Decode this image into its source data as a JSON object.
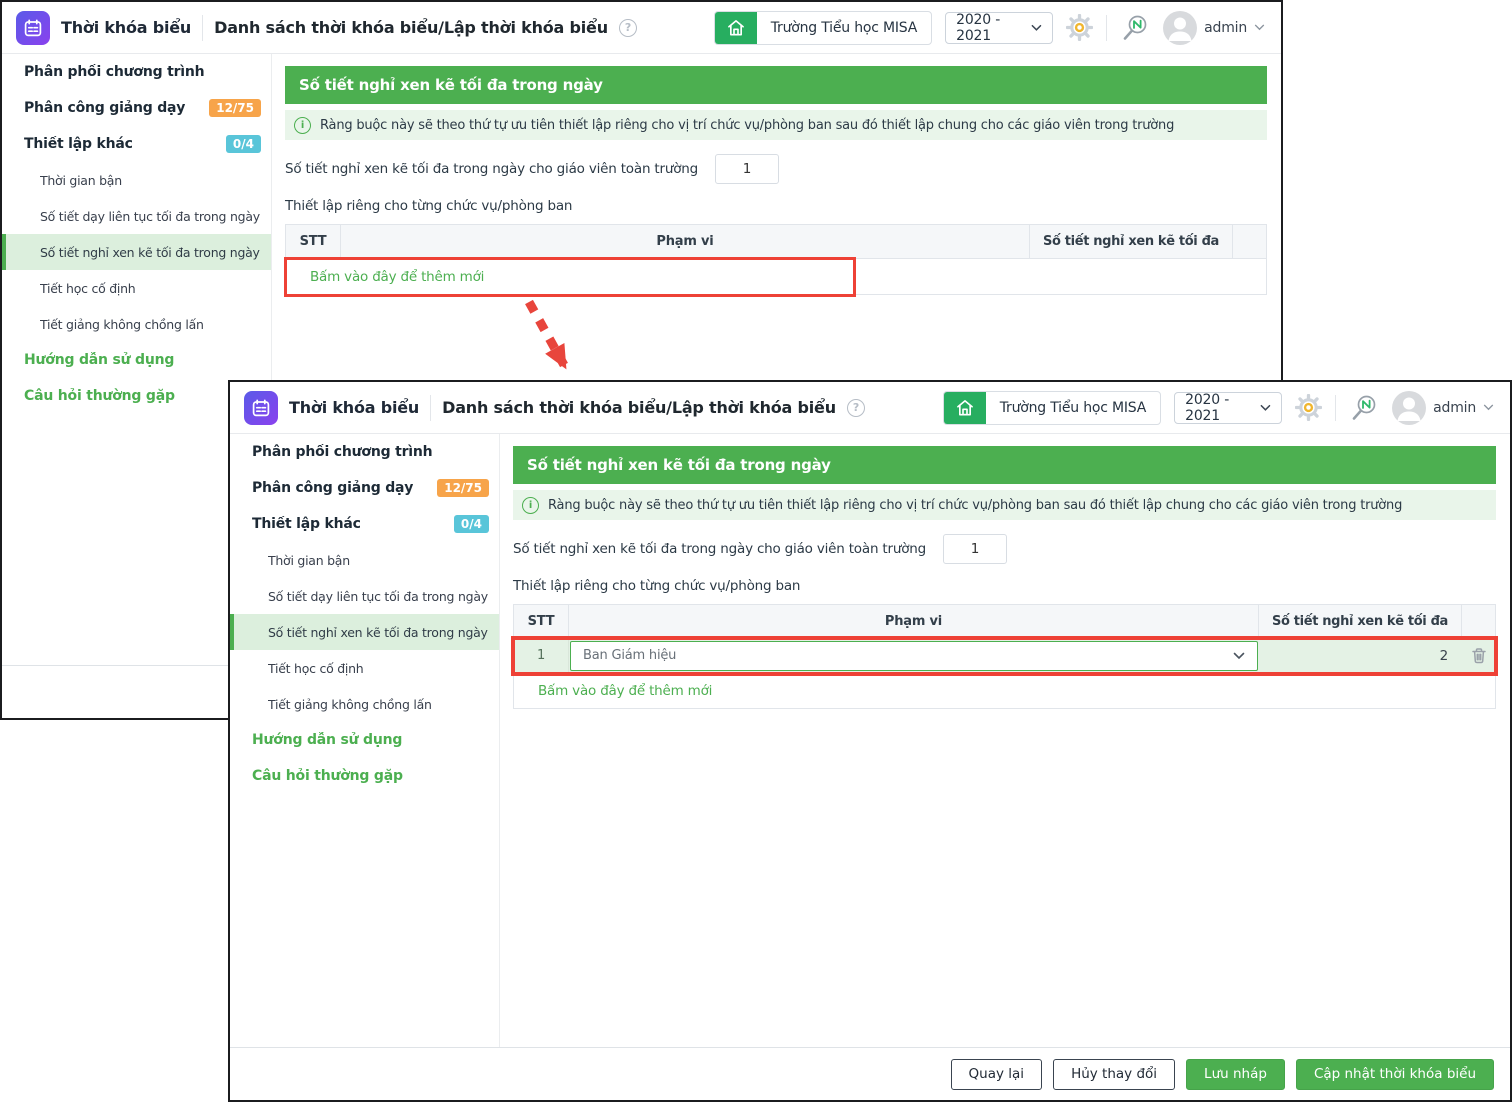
{
  "app": {
    "name": "Thời khóa biểu",
    "page_title": "Danh sách thời khóa biểu/Lập thời khóa biểu",
    "school": "Trường Tiểu học MISA",
    "year": "2020 - 2021",
    "user": "admin",
    "help_glyph": "?",
    "info_glyph": "i"
  },
  "sidebar": {
    "items": [
      {
        "label": "Phân phối chương trình"
      },
      {
        "label": "Phân công giảng dạy",
        "badge": "12/75"
      },
      {
        "label": "Thiết lập khác",
        "badge": "0/4"
      },
      {
        "label": "Thời gian bận"
      },
      {
        "label": "Số tiết dạy liên tục tối đa trong ngày"
      },
      {
        "label": "Số tiết nghỉ xen kẽ tối đa trong ngày",
        "selected": true
      },
      {
        "label": "Tiết học cố định"
      },
      {
        "label": "Tiết giảng không chồng lấn"
      },
      {
        "label": "Hướng dẫn sử dụng"
      },
      {
        "label": "Câu hỏi thường gặp"
      }
    ]
  },
  "panel": {
    "title": "Số tiết nghỉ xen kẽ tối đa trong ngày",
    "info_text": "Ràng buộc này sẽ theo thứ tự ưu tiên thiết lập riêng cho vị trí chức vụ/phòng ban sau đó thiết lập chung cho các giáo viên trong trường",
    "global_setting_label": "Số tiết nghỉ xen kẽ tối đa trong ngày cho giáo viên toàn trường",
    "global_setting_value": "1",
    "custom_setting_label": "Thiết lập riêng cho từng chức vụ/phòng ban"
  },
  "table": {
    "col_stt": "STT",
    "col_pham_vi": "Phạm vi",
    "col_so_tiet": "Số tiết nghỉ xen kẽ tối đa",
    "row": {
      "stt": "1",
      "pham_vi": "Ban Giám hiệu",
      "so_tiet": "2"
    },
    "add_new_label": "Bấm vào đây để thêm mới"
  },
  "footer": {
    "back": "Quay lại",
    "cancel": "Hủy thay đổi",
    "draft": "Lưu nháp",
    "update": "Cập nhật thời khóa biểu"
  },
  "colors": {
    "primary_green": "#4caf50",
    "info_bg": "#e9f5ea",
    "selected_item_bg": "#dcefdd",
    "row_highlight_bg": "#e4f2e5",
    "badge_orange": "#f7a44a",
    "badge_cyan": "#59c5d9",
    "annotation_red": "#ee4136",
    "app_icon_purple": "#6a5be2",
    "home_green": "#27ae60",
    "window_border": "#1b1c1f"
  }
}
